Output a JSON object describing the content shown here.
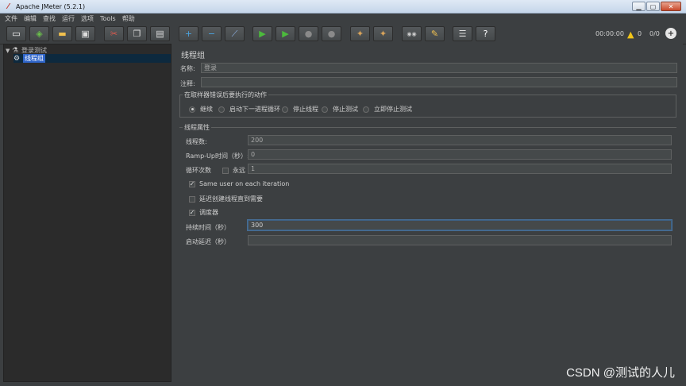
{
  "window": {
    "title": "Apache JMeter (5.2.1)"
  },
  "menu": [
    "文件",
    "编辑",
    "查找",
    "运行",
    "选项",
    "Tools",
    "帮助"
  ],
  "toolbar": {
    "timer": "00:00:00",
    "warning_count": "0",
    "threads": "0/0",
    "buttons": [
      {
        "name": "new",
        "glyph": "▭",
        "color": "#ffffff"
      },
      {
        "name": "templates",
        "glyph": "◈",
        "color": "#6abf4b"
      },
      {
        "name": "open",
        "glyph": "▬",
        "color": "#f2c14e"
      },
      {
        "name": "save",
        "glyph": "▣",
        "color": "#dddddd"
      },
      {
        "name": "cut",
        "glyph": "✂",
        "color": "#e05a4e"
      },
      {
        "name": "copy",
        "glyph": "❐",
        "color": "#dddddd"
      },
      {
        "name": "paste",
        "glyph": "▤",
        "color": "#dddddd"
      },
      {
        "name": "expand",
        "glyph": "+",
        "color": "#4aa3df"
      },
      {
        "name": "collapse",
        "glyph": "−",
        "color": "#4aa3df"
      },
      {
        "name": "toggle",
        "glyph": "⟋",
        "color": "#8fb4e8"
      },
      {
        "name": "start",
        "glyph": "▶",
        "color": "#4cbb3c"
      },
      {
        "name": "start-no-pauses",
        "glyph": "▶",
        "color": "#4cbb3c"
      },
      {
        "name": "stop",
        "glyph": "●",
        "color": "#8a8a8a"
      },
      {
        "name": "shutdown",
        "glyph": "●",
        "color": "#8a8a8a"
      },
      {
        "name": "clear",
        "glyph": "✦",
        "color": "#d9a45b"
      },
      {
        "name": "clear-all",
        "glyph": "✦",
        "color": "#d9a45b"
      },
      {
        "name": "search",
        "glyph": "◉◉",
        "color": "#cccccc"
      },
      {
        "name": "reset-search",
        "glyph": "✎",
        "color": "#f2c14e"
      },
      {
        "name": "function-helper",
        "glyph": "☰",
        "color": "#dddddd"
      },
      {
        "name": "help",
        "glyph": "?",
        "color": "#ffffff"
      }
    ]
  },
  "tree": [
    {
      "label": "登录测试",
      "icon": "⚗",
      "toggle": "▼"
    },
    {
      "label": "线程组",
      "icon": "⚙",
      "toggle": ""
    }
  ],
  "panel": {
    "title": "线程组",
    "name_label": "名称:",
    "name_value": "登录",
    "comment_label": "注释:",
    "comment_value": "",
    "error_group_title": "在取样器错误后要执行的动作",
    "error_actions": [
      "继续",
      "启动下一进程循环",
      "停止线程",
      "停止测试",
      "立即停止测试"
    ],
    "error_selected": 0,
    "thread_props_title": "线程属性",
    "threads_label": "线程数:",
    "threads_value": "200",
    "rampup_label": "Ramp-Up时间（秒）:",
    "rampup_value": "0",
    "loop_label": "循环次数",
    "forever_label": "永远",
    "loop_value": "1",
    "same_user_label": "Same user on each iteration",
    "delay_label": "延迟创建线程直到需要",
    "scheduler_label": "调度器",
    "duration_label": "持续时间（秒）",
    "duration_value": "300",
    "startup_delay_label": "启动延迟（秒）",
    "startup_delay_value": ""
  },
  "watermark": "CSDN @测试的人儿"
}
